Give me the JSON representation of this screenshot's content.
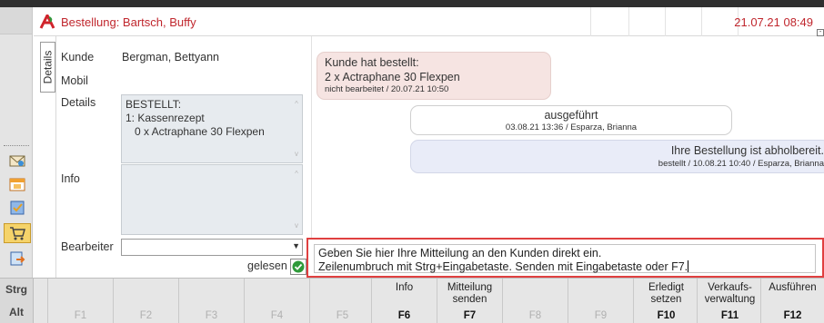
{
  "header": {
    "title": "Bestellung: Bartsch, Buffy",
    "datetime": "21.07.21 08:49"
  },
  "details_tab": "Details",
  "fields": {
    "kunde_label": "Kunde",
    "kunde_value": "Bergman, Bettyann",
    "mobil_label": "Mobil",
    "details_label": "Details",
    "details_lines": [
      "BESTELLT:",
      "1: Kassenrezept",
      "0 x Actraphane 30 Flexpen"
    ],
    "info_label": "Info",
    "bearbeiter_label": "Bearbeiter",
    "gelesen_label": "gelesen"
  },
  "messages": [
    {
      "lines": [
        "Kunde hat bestellt:",
        "2 x Actraphane 30 Flexpen"
      ],
      "meta": "nicht bearbeitet / 20.07.21 10:50"
    },
    {
      "lines": [
        "ausgeführt"
      ],
      "meta": "03.08.21 13:36 / Esparza, Brianna"
    },
    {
      "lines": [
        "Ihre Bestellung ist abholbereit."
      ],
      "meta": "bestellt / 10.08.21 10:40 / Esparza, Brianna"
    }
  ],
  "message_input": {
    "line1": "Geben Sie hier Ihre Mitteilung an den Kunden direkt ein.",
    "line2": "Zeilenumbruch mit Strg+Eingabetaste. Senden mit Eingabetaste oder F7."
  },
  "function_bar": {
    "strg": "Strg",
    "alt": "Alt",
    "keys": [
      {
        "key": "F1",
        "label": ""
      },
      {
        "key": "F2",
        "label": ""
      },
      {
        "key": "F3",
        "label": ""
      },
      {
        "key": "F4",
        "label": ""
      },
      {
        "key": "F5",
        "label": ""
      },
      {
        "key": "F6",
        "label": "Info"
      },
      {
        "key": "F7",
        "label": "Mitteilung senden"
      },
      {
        "key": "F8",
        "label": ""
      },
      {
        "key": "F9",
        "label": ""
      },
      {
        "key": "F10",
        "label": "Erledigt setzen"
      },
      {
        "key": "F11",
        "label": "Verkaufs-verwaltung"
      },
      {
        "key": "F12",
        "label": "Ausführen"
      }
    ]
  },
  "icons": {
    "logo": "apotheke-a-logo-icon",
    "left_strip": [
      "envelope-icon",
      "calendar-icon",
      "checklist-icon",
      "shopping-cart-icon",
      "export-icon"
    ],
    "checkmark": "green-check-icon"
  },
  "colors": {
    "title_red": "#c0262d",
    "highlight_red": "#e04040",
    "bubble_customer": "#f6e4e2",
    "bubble_pharmacy": "#e9ecf8",
    "selected_yellow": "#f5d36a"
  }
}
